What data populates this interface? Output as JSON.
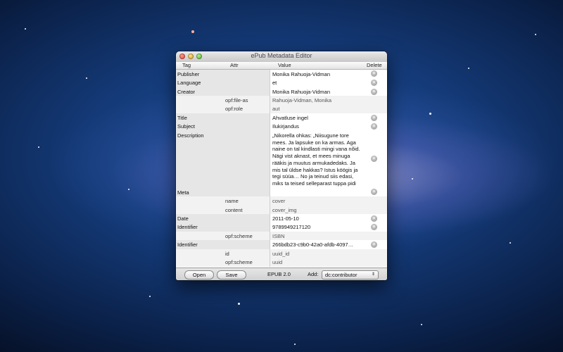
{
  "window": {
    "title": "ePub Metadata Editor"
  },
  "columns": {
    "tag": "Tag",
    "attr": "Attr",
    "value": "Value",
    "delete": "Delete"
  },
  "rows": [
    {
      "tag": "Publisher",
      "value": "Monika Rahuoja-Vidman"
    },
    {
      "tag": "Language",
      "value": "et"
    },
    {
      "tag": "Creator",
      "value": "Monika Rahuoja-Vidman"
    },
    {
      "attr": "opf:file-as",
      "value": "Rahuoja-Vidman, Monika"
    },
    {
      "attr": "opf:role",
      "value": "aut"
    },
    {
      "tag": "Title",
      "value": "Ahvatluse ingel"
    },
    {
      "tag": "Subject",
      "value": "Ilukirjandus"
    },
    {
      "tag": "Description",
      "value": "„Nikorella ohkas: „Niisugune tore mees. Ja lapsuke on ka armas. Aga naine on tal kindlasti mingi vana nõid. Nägi vist aknast, et mees minuga rääkis ja muutus armukadedaks. Ja mis tal üldse hakkas? Istus köögis ja tegi süüa… No ja teinud siis edasi, miks ta teised selleparast tuppa pidi"
    },
    {
      "tag": "Meta",
      "value": ""
    },
    {
      "attr": "name",
      "value": "cover"
    },
    {
      "attr": "content",
      "value": "cover_img"
    },
    {
      "tag": "Date",
      "value": "2011-05-10"
    },
    {
      "tag": "Identifier",
      "value": "9789949217120"
    },
    {
      "attr": "opf:scheme",
      "value": "ISBN"
    },
    {
      "tag": "Identifier",
      "value": "266bdb23-c9b0-42a0-afdb-4097…"
    },
    {
      "attr": "id",
      "value": "uuid_id"
    },
    {
      "attr": "opf:scheme",
      "value": "uuid"
    }
  ],
  "bottom": {
    "open_label": "Open",
    "save_label": "Save",
    "version": "EPUB 2.0",
    "add_label": "Add:",
    "add_selected": "dc:contributor"
  }
}
